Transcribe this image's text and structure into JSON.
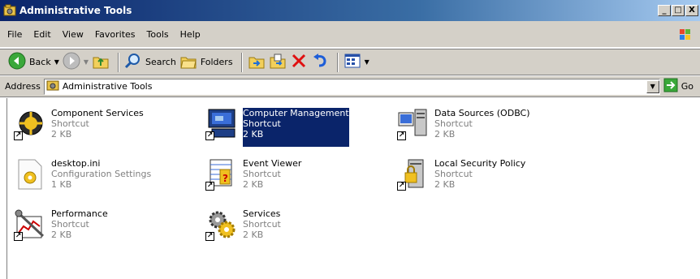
{
  "window": {
    "title": "Administrative Tools",
    "minimize": "_",
    "maximize": "□",
    "close": "X"
  },
  "menu": [
    "File",
    "Edit",
    "View",
    "Favorites",
    "Tools",
    "Help"
  ],
  "toolbar": {
    "back": "Back",
    "search": "Search",
    "folders": "Folders"
  },
  "address": {
    "label": "Address",
    "value": "Administrative Tools",
    "go": "Go"
  },
  "items": [
    {
      "name": "Component Services",
      "type": "Shortcut",
      "size": "2 KB",
      "icon": "component-services-icon",
      "shortcut": true
    },
    {
      "name": "Computer Management",
      "type": "Shortcut",
      "size": "2 KB",
      "icon": "computer-management-icon",
      "shortcut": true,
      "selected": true
    },
    {
      "name": "Data Sources (ODBC)",
      "type": "Shortcut",
      "size": "2 KB",
      "icon": "data-sources-icon",
      "shortcut": true
    },
    {
      "name": "desktop.ini",
      "type": "Configuration Settings",
      "size": "1 KB",
      "icon": "config-file-icon",
      "shortcut": false
    },
    {
      "name": "Event Viewer",
      "type": "Shortcut",
      "size": "2 KB",
      "icon": "event-viewer-icon",
      "shortcut": true
    },
    {
      "name": "Local Security Policy",
      "type": "Shortcut",
      "size": "2 KB",
      "icon": "local-security-policy-icon",
      "shortcut": true
    },
    {
      "name": "Performance",
      "type": "Shortcut",
      "size": "2 KB",
      "icon": "performance-icon",
      "shortcut": true
    },
    {
      "name": "Services",
      "type": "Shortcut",
      "size": "2 KB",
      "icon": "services-icon",
      "shortcut": true
    }
  ]
}
